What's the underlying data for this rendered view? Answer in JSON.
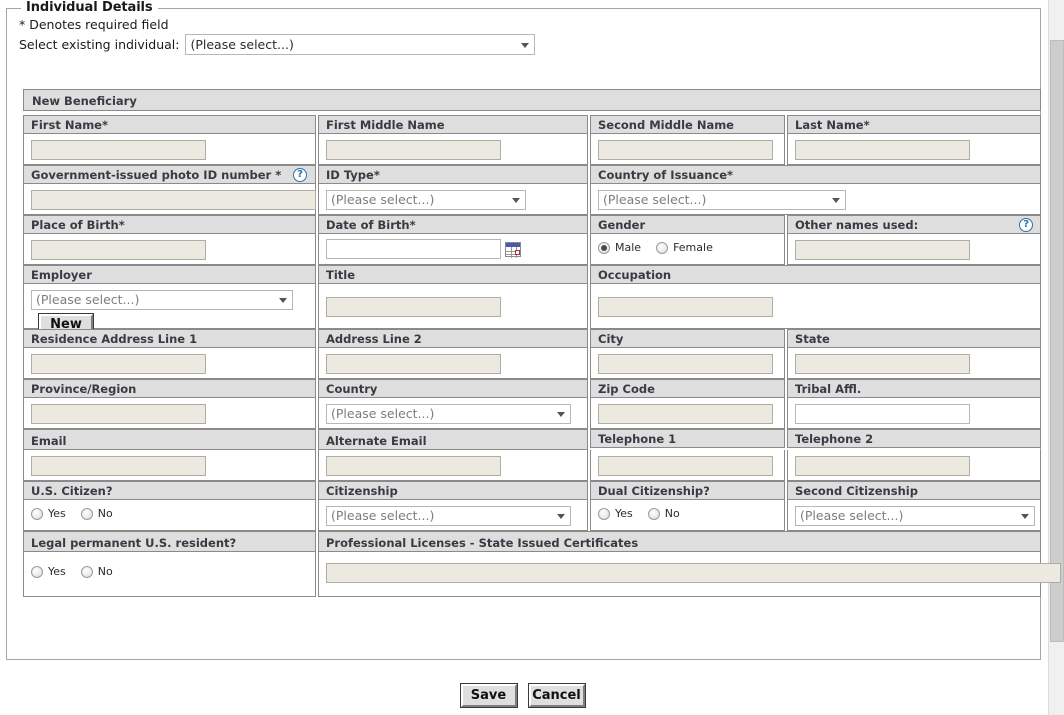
{
  "fieldset": {
    "legend": "Individual Details",
    "required_note": "* Denotes required field",
    "select_existing_label": "Select existing individual:",
    "select_existing_value": "(Please select...)"
  },
  "section": {
    "title": "New Beneficiary"
  },
  "placeholders": {
    "please_select": "(Please select...)"
  },
  "icons": {
    "help": "?",
    "calendar": "calendar-icon",
    "dropdown": "chevron-down-icon"
  },
  "rows": [
    {
      "labels": [
        "First Name*",
        "First Middle Name",
        "Second Middle Name",
        "Last Name*"
      ]
    },
    {
      "labels": [
        "Government-issued photo ID number *",
        "ID Type*",
        "Country of Issuance*"
      ]
    },
    {
      "labels": [
        "Place of Birth*",
        "Date of Birth*",
        "Gender",
        "Other names used:"
      ]
    },
    {
      "labels": [
        "Employer",
        "Title",
        "Occupation"
      ]
    },
    {
      "labels": [
        "Residence Address Line 1",
        "Address Line 2",
        "City",
        "State"
      ]
    },
    {
      "labels": [
        "Province/Region",
        "Country",
        "Zip Code",
        "Tribal Affl."
      ]
    },
    {
      "labels": [
        "Email",
        "Alternate Email",
        "Telephone 1",
        "Telephone 2"
      ]
    },
    {
      "labels": [
        "U.S. Citizen?",
        "Citizenship",
        "Dual Citizenship?",
        "Second Citizenship"
      ]
    },
    {
      "labels": [
        "Legal permanent U.S. resident?",
        "Professional Licenses - State Issued Certificates"
      ]
    }
  ],
  "values": {
    "first_name": "",
    "first_middle_name": "",
    "second_middle_name": "",
    "last_name": "",
    "gov_id_number": "",
    "id_type": "(Please select...)",
    "country_of_issuance": "(Please select...)",
    "place_of_birth": "",
    "date_of_birth": "",
    "other_names_used": "",
    "employer": "(Please select...)",
    "title": "",
    "occupation": "",
    "address_line_1": "",
    "address_line_2": "",
    "city": "",
    "state": "",
    "province_region": "",
    "country": "(Please select...)",
    "zip_code": "",
    "tribal_affl": "",
    "email": "",
    "alternate_email": "",
    "telephone_1": "",
    "telephone_2": "",
    "citizenship": "(Please select...)",
    "second_citizenship": "(Please select...)",
    "professional_licenses": ""
  },
  "gender": {
    "male_label": "Male",
    "female_label": "Female",
    "selected": "Male"
  },
  "yesno": {
    "yes_label": "Yes",
    "no_label": "No"
  },
  "buttons": {
    "new": "New",
    "save": "Save",
    "cancel": "Cancel"
  },
  "colors": {
    "band": "#dedede",
    "input_bg": "#eceae0",
    "border": "#8a8a8a",
    "label_text": "#3a3a44",
    "help_blue": "#2f6fae"
  }
}
